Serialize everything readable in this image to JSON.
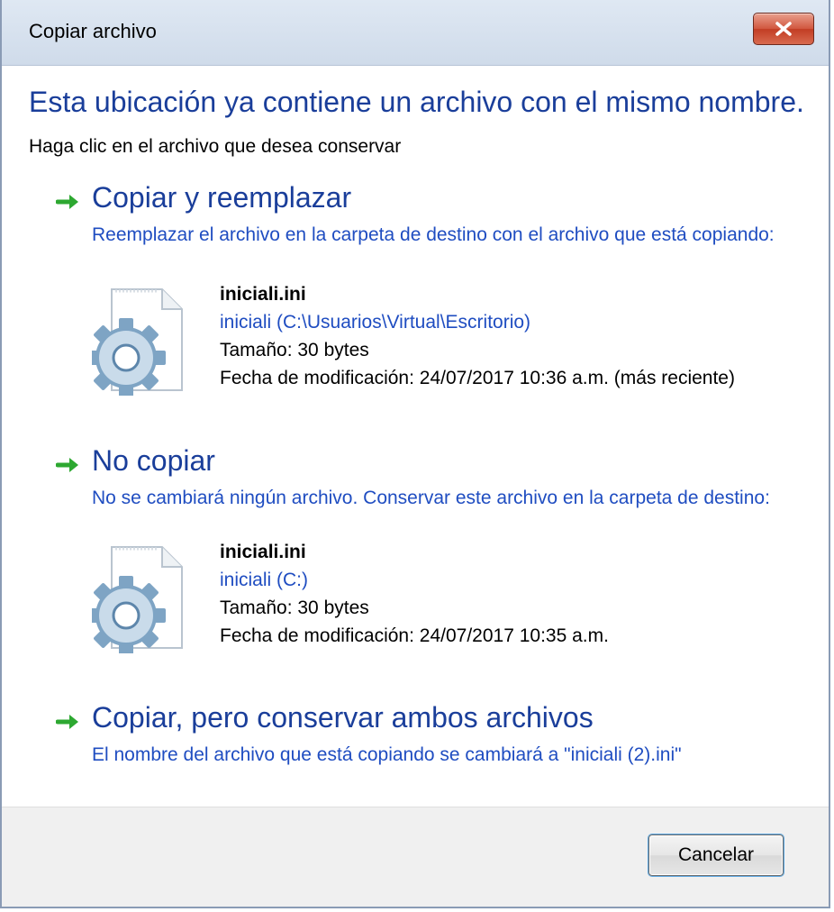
{
  "window": {
    "title": "Copiar archivo",
    "close_icon": "close-icon"
  },
  "header": {
    "headline": "Esta ubicación ya contiene un archivo con el mismo nombre.",
    "subline": "Haga clic en el archivo que desea conservar"
  },
  "options": [
    {
      "title": "Copiar y reemplazar",
      "description": "Reemplazar el archivo en la carpeta de destino con el archivo que está copiando:",
      "file": {
        "name": "iniciali.ini",
        "path": "iniciali (C:\\Usuarios\\Virtual\\Escritorio)",
        "size": "Tamaño: 30 bytes",
        "modified": "Fecha de modificación: 24/07/2017 10:36 a.m. (más reciente)"
      }
    },
    {
      "title": "No copiar",
      "description": "No se cambiará ningún archivo. Conservar este archivo en la carpeta de destino:",
      "file": {
        "name": "iniciali.ini",
        "path": "iniciali (C:)",
        "size": "Tamaño: 30 bytes",
        "modified": "Fecha de modificación: 24/07/2017 10:35 a.m."
      }
    },
    {
      "title": "Copiar, pero conservar ambos archivos",
      "description": "El nombre del archivo que está copiando se cambiará a \"iniciali (2).ini\""
    }
  ],
  "footer": {
    "cancel_label": "Cancelar"
  },
  "colors": {
    "heading_blue": "#1a3e9a",
    "link_blue": "#1f4dc1",
    "arrow_green": "#2da831",
    "close_red": "#c23d24"
  }
}
